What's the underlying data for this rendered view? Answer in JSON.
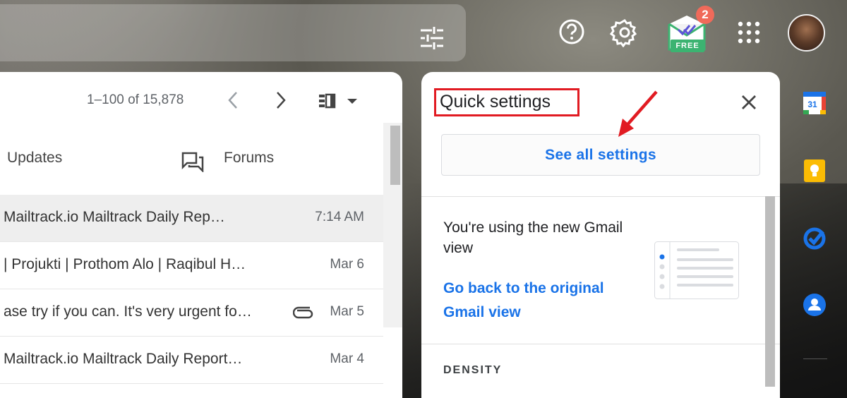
{
  "header": {
    "mailtrack_badge_count": "2",
    "mailtrack_label": "FREE"
  },
  "mail": {
    "pager": "1–100 of 15,878",
    "tabs": [
      {
        "label": "Updates"
      },
      {
        "label": "Forums"
      }
    ],
    "rows": [
      {
        "subject": "Mailtrack.io Mailtrack Daily Rep…",
        "date": "7:14 AM",
        "attachment": false
      },
      {
        "subject": "| Projukti | Prothom Alo | Raqibul H…",
        "date": "Mar 6",
        "attachment": false
      },
      {
        "subject": "ase try if you can. It's very urgent fo…",
        "date": "Mar 5",
        "attachment": true
      },
      {
        "subject": "Mailtrack.io Mailtrack Daily Report…",
        "date": "Mar 4",
        "attachment": false
      }
    ]
  },
  "quick_settings": {
    "title": "Quick settings",
    "see_all_label": "See all settings",
    "view_text": "You're using the new Gmail view",
    "go_back_link": "Go back to the original Gmail view",
    "density_label": "DENSITY"
  },
  "colors": {
    "link_blue": "#1a73e8",
    "annotation_red": "#e11b22",
    "badge": "#f06a5a"
  },
  "icons": [
    "filter-icon",
    "help-icon",
    "gear-icon",
    "mailtrack-icon",
    "apps-icon",
    "avatar",
    "chevron-left-icon",
    "chevron-right-icon",
    "split-pane-icon",
    "forums-icon",
    "attachment-icon",
    "close-icon",
    "calendar-icon",
    "keep-icon",
    "tasks-icon",
    "contacts-icon"
  ]
}
